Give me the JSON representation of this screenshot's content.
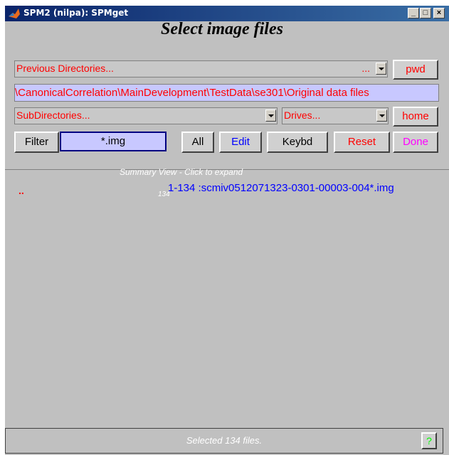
{
  "window": {
    "title": "SPM2 (nilpa): SPMget",
    "controls": {
      "minimize": "_",
      "maximize": "□",
      "close": "×"
    }
  },
  "heading": "Select image files",
  "previous_dirs": {
    "label": "Previous Directories...",
    "ellipsis": "..."
  },
  "pwd_label": "pwd",
  "current_dir": "\\CanonicalCorrelation\\MainDevelopment\\TestData\\se301\\Original data files",
  "subdirs_label": "SubDirectories...",
  "drives_label": "Drives...",
  "home_label": "home",
  "filter": {
    "label": "Filter",
    "value": "*.img"
  },
  "buttons": {
    "all": "All",
    "edit": "Edit",
    "keybd": "Keybd",
    "reset": "Reset",
    "done": "Done"
  },
  "summary_view": "Summary View - Click to expand",
  "file_list": {
    "marker": "..",
    "count": "134",
    "entry": "1-134 :scmiv0512071323-0301-00003-004*.img"
  },
  "status": "Selected 134 files.",
  "help_label": "?",
  "colors": {
    "red": "#ff0000",
    "blue": "#0000ff",
    "magenta": "#ff00ff",
    "green": "#00ff00",
    "lavender": "#c8c8ff",
    "panel": "#c0c0c0"
  }
}
